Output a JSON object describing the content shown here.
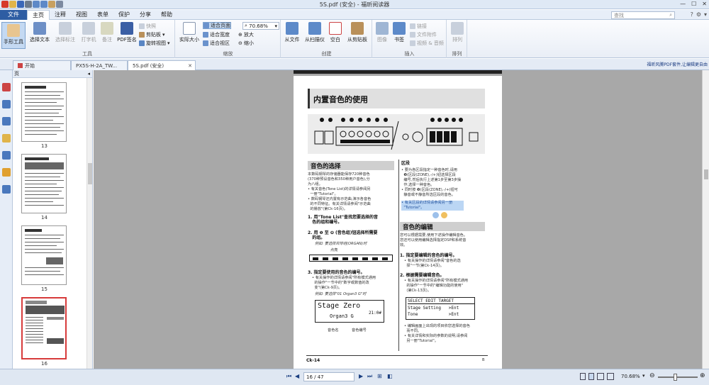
{
  "window": {
    "title": "5S.pdf (安全) - 福昕阅读器"
  },
  "menu": {
    "file": "文件",
    "items": [
      "主页",
      "注释",
      "视图",
      "表单",
      "保护",
      "分享",
      "帮助"
    ],
    "search_placeholder": "查找"
  },
  "ribbon": {
    "tools": {
      "hand": "手形工具",
      "select_text": "选择文本",
      "select_annot": "选择标注",
      "typewriter": "打字机",
      "note": "备注",
      "pdf_sign": "PDF签名",
      "snapshot": "快照",
      "clipboard": "剪贴板",
      "rotate": "旋转视图",
      "group": "工具"
    },
    "zoom": {
      "actual_size": "实际大小",
      "fit_page": "适合页面",
      "fit_width": "适合宽度",
      "fit_visible": "适合视区",
      "zoom_value": "70.68%",
      "zoom_in": "放大",
      "zoom_out": "缩小",
      "group": "缩放"
    },
    "create": {
      "from_file": "从文件",
      "from_scanner": "从扫描仪",
      "blank": "空白",
      "from_clipboard": "从剪贴板",
      "group": "创建"
    },
    "insert": {
      "image": "图像",
      "bookmark": "书签",
      "link": "链接",
      "attachment": "文件附件",
      "media": "视频 & 音频",
      "group": "插入"
    },
    "arrange": {
      "label": "排列",
      "group": "排列"
    }
  },
  "tabs": [
    {
      "label": "开始"
    },
    {
      "label": "PX5S-H-2A_TW..."
    },
    {
      "label": "5S.pdf (安全)"
    }
  ],
  "notice": "福昕风腾PDF套件,让编辑更自由",
  "thumbnails": {
    "header": "页",
    "pages": [
      "13",
      "14",
      "15",
      "16"
    ],
    "selected": "16"
  },
  "page": {
    "title": "内置音色的使用",
    "left_heading": "音色的选择",
    "intro": "本数码钢琴的存储器能保存720种音色\n(370种预设音色和350种用户音色),分\n为八组。\n• 有关音色(Tone List)的详情请参阅另\n  一册\"Tutorial\"。\n• 数码钢琴还内置有示范曲,演示各音色\n  的不同特征。有关详情请参阅\"示范曲\n  的播放\"(第Ck-16页)。",
    "step1": "1. 用\"Tone List\"查找您要选择的音\n   色的组和编号。",
    "step2": "2. 用 ❶ 至 ❽ (音色组)钮选择所需要\n   的组。",
    "step2_note": "例如: 要选择风琴组(ORGAN)时",
    "step2_label": "点亮",
    "step3": "3. 指定要使用的音色的编号。",
    "step3_body": "• 有关操作的详情请参阅\"所有模式通用\n  的操作\"一节中的\"数字或数值的改\n  变\"(第Ck-9页)。",
    "step3_note": "例如: 要选择\"01 Organ3 G\"时",
    "lcd1_line1": "Stage Zero",
    "lcd1_line2": "Organ3 G",
    "lcd1_status": "21:0#",
    "lcd_label1": "音色名",
    "lcd_label2": "音色编号",
    "right_heading_note": "区段",
    "right_body": "• 要为各区段指定一种音色时,请用\n  ❾(区段(ZONE),-/+)钮选择区段\n  编号,然后执行上述第1步至第3步操\n  作,选择一种音色。\n• 同时按 ❾(区段(ZONE),-/+)钮可\n  静音或不静音所选区段的音色。",
    "right_highlight": "• 有关区段的详情请参阅另一册\n  \"Tutorial\"。",
    "right_heading": "音色的编辑",
    "edit_intro": "您可以根据需要,使用下述操作编辑音色。\n您还可以使用编辑选择指定DSP和系统音\n效。",
    "edit_step1": "1. 指定要编辑的音色的编号。",
    "edit_step1_body": "• 有关操作的详情请参阅\"音色的选\n  择\"一节(第Ck-14页)。",
    "edit_step2": "2. 根据需要编辑音色。",
    "edit_step2_body": "• 有关操作的详情请参阅\"所有模式通用\n  的操作\"一节中的\"编辑功能的使用\"\n  (第Ck-13页)。",
    "lcd2_line1": "SELECT EDIT TARGET",
    "lcd2_line2": "Stage Setting   >Ent",
    "lcd2_line3": "Tone            >Ent",
    "edit_foot": "• 编辑画面上出现的项目依您选择的音色\n  而不同。\n• 有关详情和实际的参数的说明,请参阅\n  另一册\"Tutorial\"。",
    "footer_left": "Ck-14",
    "footer_right": "B"
  },
  "status": {
    "page_indicator": "16 / 47",
    "zoom_value": "70.68%"
  }
}
